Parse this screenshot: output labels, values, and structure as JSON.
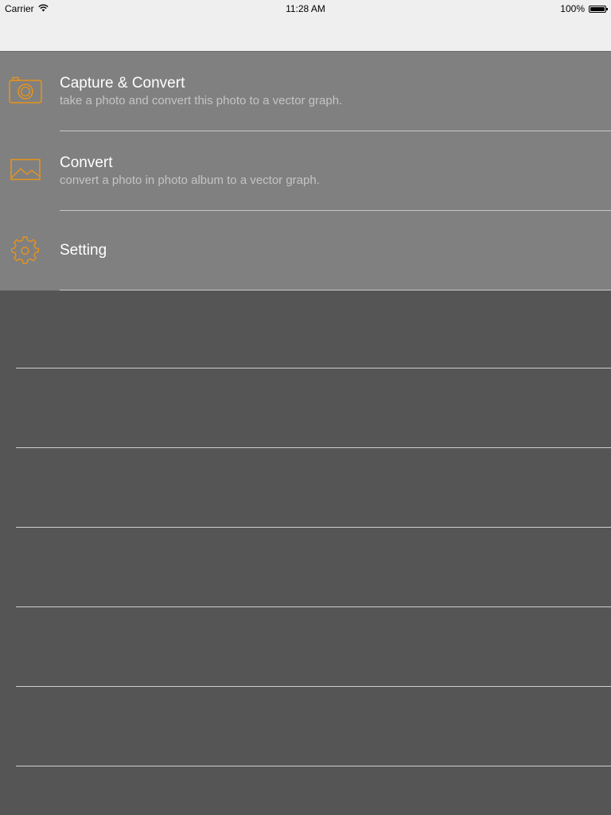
{
  "status_bar": {
    "carrier": "Carrier",
    "time": "11:28 AM",
    "battery_percent": "100%",
    "battery_level": 1.0,
    "wifi_icon": "wifi-icon"
  },
  "colors": {
    "accent": "#e8941a",
    "menu_background": "#808080",
    "page_background": "#555555"
  },
  "menu": {
    "items": [
      {
        "title": "Capture & Convert",
        "subtitle": "take a photo and convert this photo to a vector graph.",
        "icon": "camera-icon"
      },
      {
        "title": "Convert",
        "subtitle": "convert a photo in photo album to a vector graph.",
        "icon": "image-icon"
      },
      {
        "title": "Setting",
        "icon": "gear-icon"
      }
    ]
  }
}
